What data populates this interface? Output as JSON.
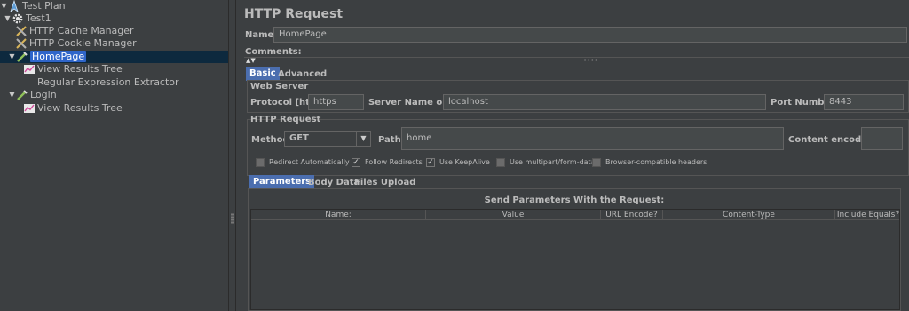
{
  "tree": {
    "items": [
      {
        "label": "Test Plan",
        "icon": "test-plan-icon"
      },
      {
        "label": "Test1",
        "icon": "thread-group-gear-icon"
      },
      {
        "label": "HTTP Cache Manager",
        "icon": "config-wrench-icon"
      },
      {
        "label": "HTTP Cookie Manager",
        "icon": "config-wrench-icon"
      },
      {
        "label": "HomePage",
        "icon": "sampler-pipette-icon"
      },
      {
        "label": "View Results Tree",
        "icon": "listener-chart-icon"
      },
      {
        "label": "Regular Expression Extractor",
        "icon": "post-processor-icon"
      },
      {
        "label": "Login",
        "icon": "sampler-pipette-icon"
      },
      {
        "label": "View Results Tree",
        "icon": "listener-chart-icon"
      }
    ],
    "selected": "HomePage"
  },
  "main": {
    "title": "HTTP Request",
    "name_label": "Name:",
    "name_value": "HomePage",
    "comments_label": "Comments:",
    "tabs": [
      {
        "label": "Basic"
      },
      {
        "label": "Advanced"
      }
    ],
    "web_server": {
      "title": "Web Server",
      "protocol_label": "Protocol [http]:",
      "protocol_value": "https",
      "server_label": "Server Name or IP:",
      "server_value": "localhost",
      "port_label": "Port Number:",
      "port_value": "8443"
    },
    "http_request": {
      "title": "HTTP Request",
      "method_label": "Method:",
      "method_value": "GET",
      "path_label": "Path:",
      "path_value": "home",
      "encoding_label": "Content encoding:",
      "encoding_value": ""
    },
    "options": [
      {
        "label": "Redirect Automatically",
        "checked": false
      },
      {
        "label": "Follow Redirects",
        "checked": true
      },
      {
        "label": "Use KeepAlive",
        "checked": true
      },
      {
        "label": "Use multipart/form-data",
        "checked": false
      },
      {
        "label": "Browser-compatible headers",
        "checked": false
      }
    ],
    "sub_tabs": [
      {
        "label": "Parameters"
      },
      {
        "label": "Body Data"
      },
      {
        "label": "Files Upload"
      }
    ],
    "params": {
      "title": "Send Parameters With the Request:",
      "columns": [
        "Name:",
        "Value",
        "URL Encode?",
        "Content-Type",
        "Include Equals?"
      ]
    }
  },
  "colors": {
    "background": "#3c3f41",
    "selection": "#2f65ca",
    "active_tab": "#4b6eaf",
    "field_bg": "#45494a"
  }
}
